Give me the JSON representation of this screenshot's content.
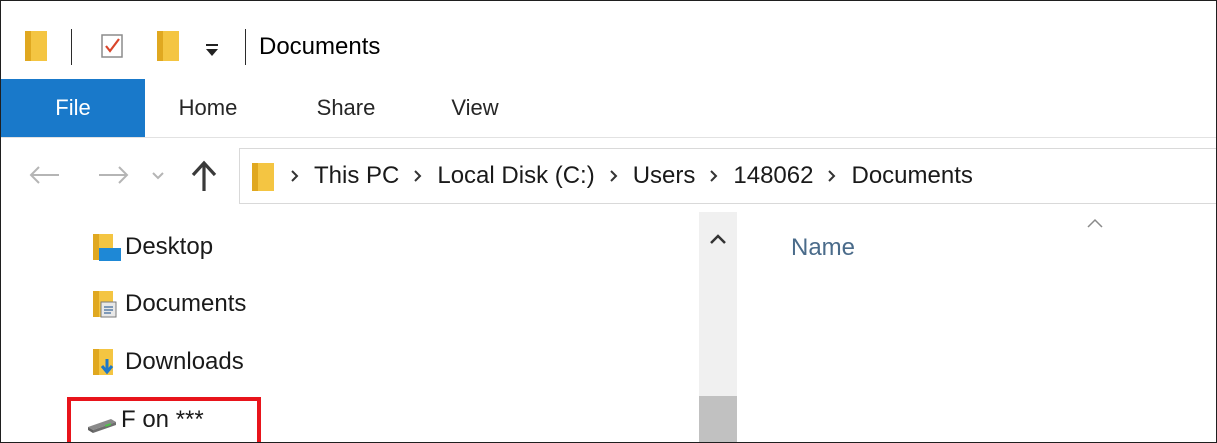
{
  "window": {
    "title": "Documents"
  },
  "quick_access": {
    "icons": [
      "folder-icon",
      "properties-icon",
      "new-folder-icon",
      "customize-dropdown-icon"
    ]
  },
  "ribbon": {
    "tabs": [
      {
        "label": "File",
        "active": true
      },
      {
        "label": "Home"
      },
      {
        "label": "Share"
      },
      {
        "label": "View"
      }
    ],
    "accent": "#1979ca"
  },
  "nav": {
    "buttons": [
      "back-arrow-icon",
      "forward-arrow-icon",
      "recent-dropdown-icon",
      "up-arrow-icon"
    ]
  },
  "address": {
    "crumbs": [
      "This PC",
      "Local Disk (C:)",
      "Users",
      "148062",
      "Documents"
    ]
  },
  "navpane": {
    "items": [
      {
        "label": "Desktop",
        "icon": "desktop-folder-icon"
      },
      {
        "label": "Documents",
        "icon": "documents-folder-icon"
      },
      {
        "label": "Downloads",
        "icon": "downloads-folder-icon"
      },
      {
        "label": "F on ***",
        "icon": "network-drive-icon",
        "highlighted": true
      }
    ],
    "highlight_color": "#e8141b"
  },
  "content": {
    "columns": [
      {
        "label": "Name",
        "sorted": "ascending"
      }
    ]
  }
}
